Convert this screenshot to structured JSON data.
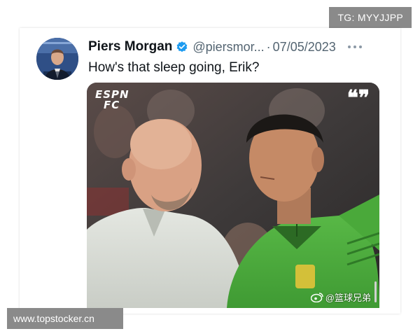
{
  "overlay": {
    "telegram_tag": "TG: MYYJJPP",
    "site_url": "www.topstocker.cn"
  },
  "tweet": {
    "display_name": "Piers Morgan",
    "handle": "@piersmor...",
    "separator": "·",
    "date": "07/05/2023",
    "text": "How's that sleep going, Erik?",
    "verified": true,
    "media": {
      "logo_text_line1": "ESPN",
      "logo_text_line2": "FC",
      "quote_mark": "❝❞",
      "watermark": "@篮球兄弟"
    }
  },
  "colors": {
    "brand_blue": "#1d9bf0",
    "text_primary": "#0f1419",
    "text_secondary": "#536471",
    "badge_grey": "#8a8a8a",
    "kit_green": "#4fae3e"
  },
  "icons": [
    "verified-badge-icon",
    "more-options-icon",
    "espn-fc-logo",
    "quote-icon",
    "weibo-icon"
  ]
}
